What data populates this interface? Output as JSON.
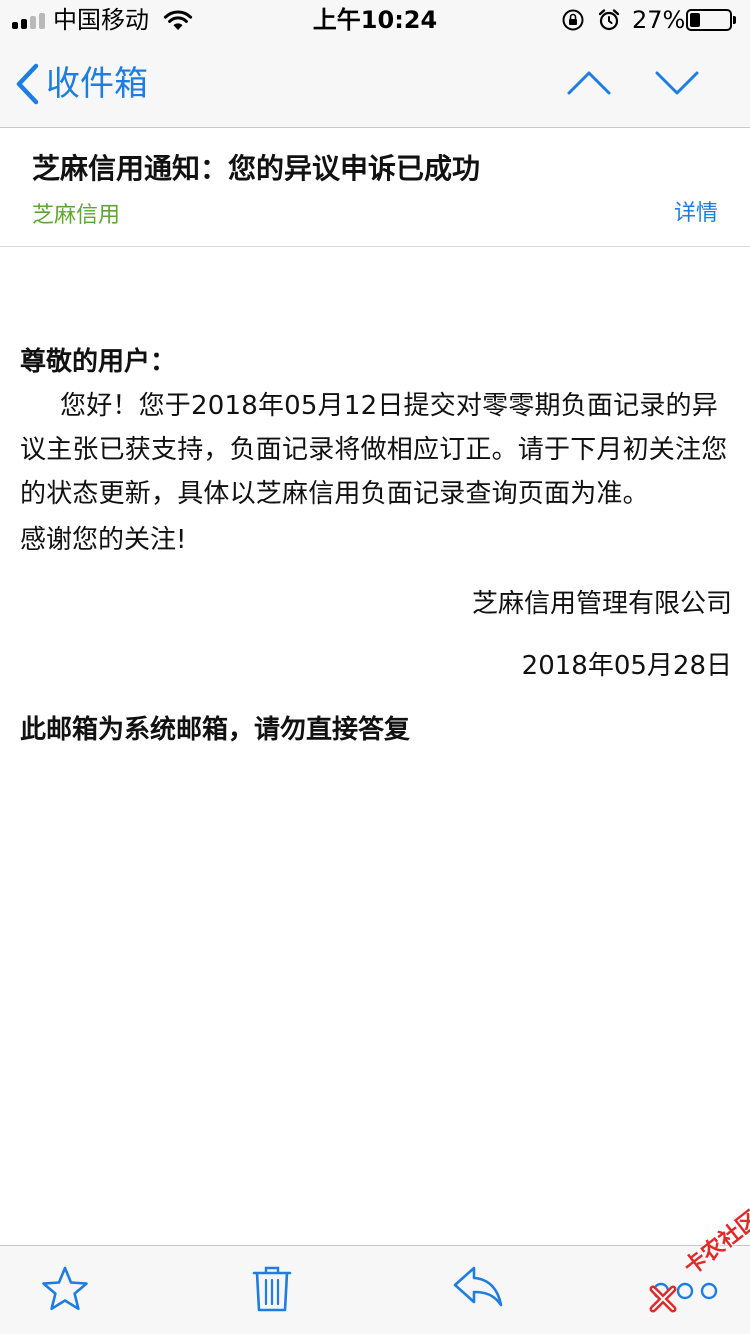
{
  "status_bar": {
    "carrier": "中国移动",
    "time": "上午10:24",
    "battery_percent": "27%",
    "battery_level": 0.27,
    "signal_bars_filled": 2,
    "icons": [
      "signal-icon",
      "wifi-icon",
      "rotation-lock-icon",
      "alarm-icon",
      "battery-icon"
    ]
  },
  "nav": {
    "back_label": "收件箱",
    "icons": [
      "chevron-left-icon",
      "chevron-up-icon",
      "chevron-down-icon"
    ]
  },
  "mail": {
    "subject": "芝麻信用通知：您的异议申诉已成功",
    "sender": "芝麻信用",
    "detail_label": "详情",
    "greeting": "尊敬的用户：",
    "body": "您好！您于2018年05月12日提交对零零期负面记录的异议主张已获支持，负面记录将做相应订正。请于下月初关注您的状态更新，具体以芝麻信用负面记录查询页面为准。",
    "thanks": "感谢您的关注!",
    "signature_company": "芝麻信用管理有限公司",
    "signature_date": "2018年05月28日",
    "notice": "此邮箱为系统邮箱，请勿直接答复"
  },
  "toolbar": {
    "icons": [
      "star-icon",
      "trash-icon",
      "reply-icon",
      "more-icon"
    ]
  },
  "watermark": {
    "text": "卡农社区"
  },
  "colors": {
    "accent": "#1e7de0",
    "sender_green": "#5fa632",
    "bar_bg": "#f7f7f7",
    "watermark_red": "#e02a2a"
  }
}
